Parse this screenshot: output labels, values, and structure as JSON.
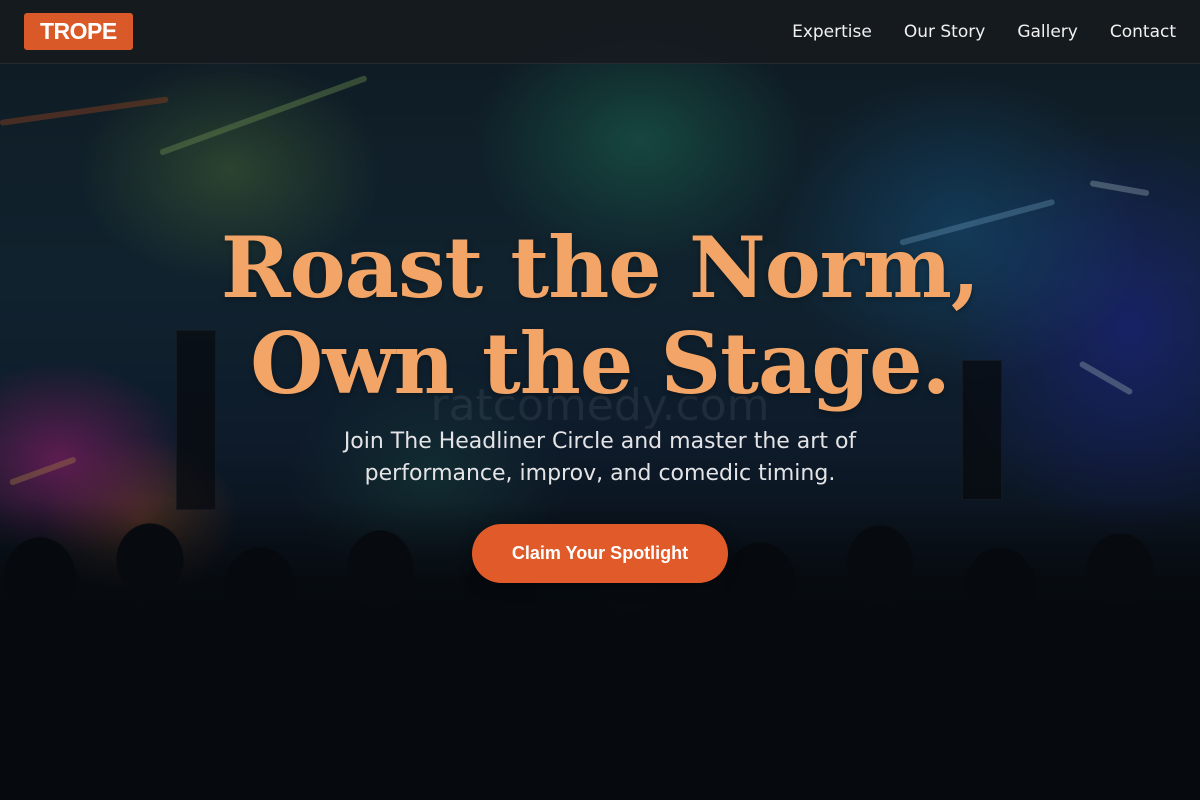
{
  "navbar": {
    "logo": "TROPE",
    "links": [
      "Expertise",
      "Our Story",
      "Gallery",
      "Contact"
    ]
  },
  "hero": {
    "title_line1": "Roast the Norm,",
    "title_line2": "Own the Stage.",
    "subtitle": "Join The Headliner Circle and master the art of performance, improv, and comedic timing.",
    "cta_label": "Claim Your Spotlight",
    "watermark": "ratcomedy.com",
    "background": "concert-crowd-photo"
  },
  "colors": {
    "accent": "#e15b2a",
    "logo_bg": "#d95a28",
    "title": "#f2a566",
    "navbar_bg": "#161a20"
  }
}
